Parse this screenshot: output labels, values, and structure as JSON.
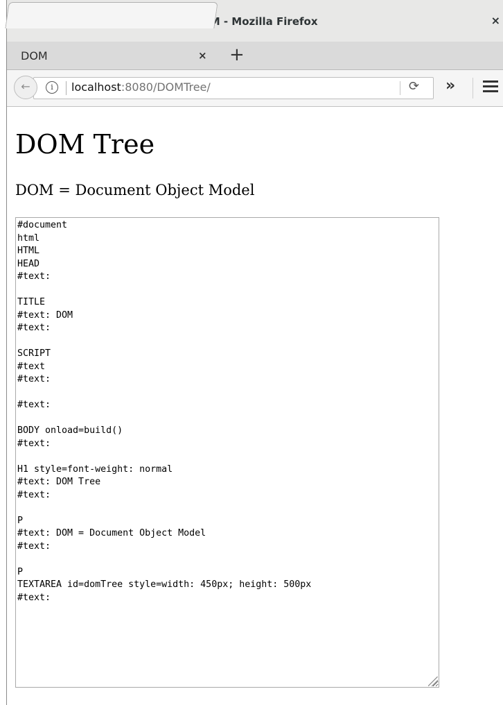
{
  "window": {
    "title": "DOM - Mozilla Firefox",
    "close_glyph": "×"
  },
  "tabs": [
    {
      "label": "DOM",
      "close_glyph": "×"
    }
  ],
  "new_tab_glyph": "+",
  "navbar": {
    "url_host": "localhost",
    "url_rest": ":8080/DOMTree/",
    "info_glyph": "i",
    "back_glyph": "←",
    "reload_glyph": "⟳",
    "overflow_glyph": "»"
  },
  "page": {
    "heading": "DOM Tree",
    "paragraph": "DOM = Document Object Model",
    "textarea_content": "#document\nhtml\nHTML\nHEAD\n#text: \n\nTITLE\n#text: DOM\n#text: \n\nSCRIPT\n#text\n#text: \n\n#text: \n\nBODY onload=build()\n#text: \n\nH1 style=font-weight: normal\n#text: DOM Tree\n#text: \n\nP\n#text: DOM = Document Object Model\n#text: \n\nP\nTEXTAREA id=domTree style=width: 450px; height: 500px\n#text: "
  }
}
